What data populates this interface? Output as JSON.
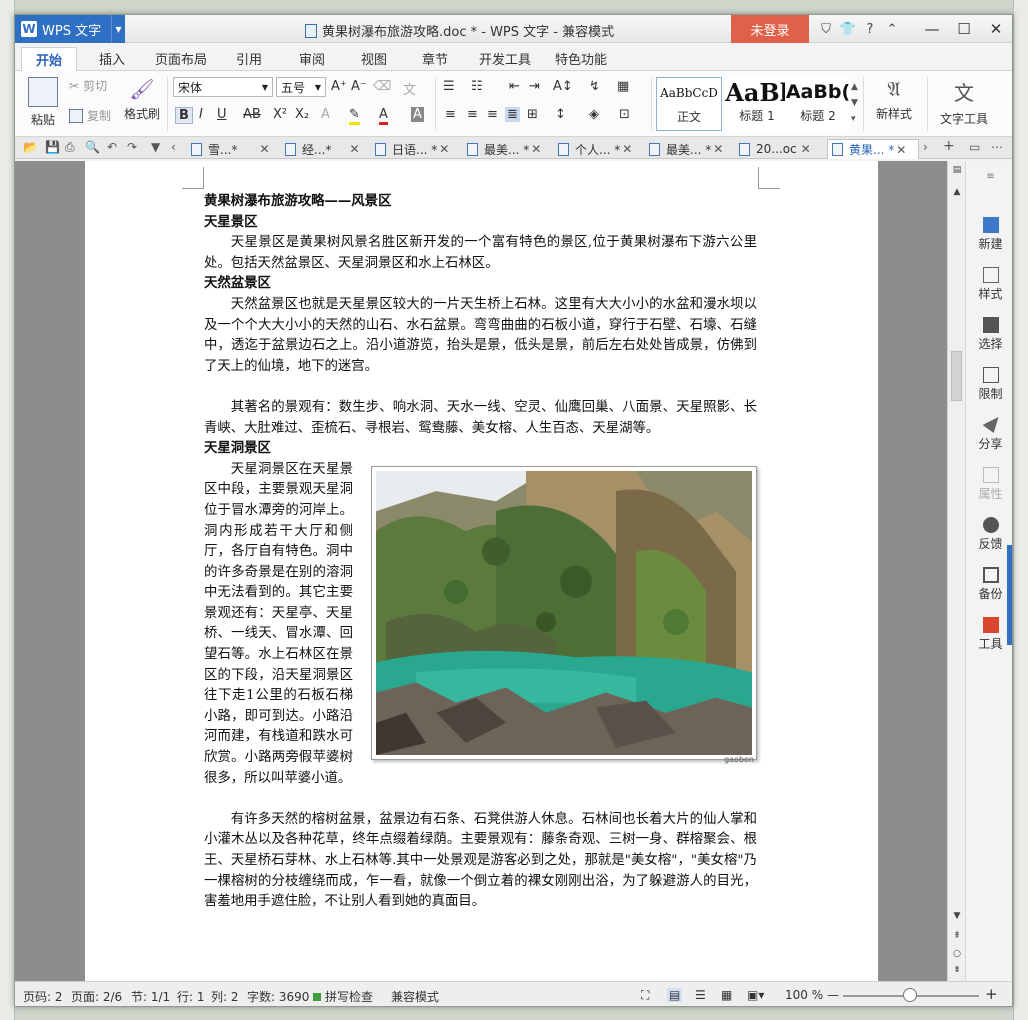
{
  "app": {
    "name": "WPS 文字",
    "window_title": "黄果树瀑布旅游攻略.doc * - WPS 文字 - 兼容模式",
    "login_label": "未登录",
    "title_icons": [
      "shield-icon",
      "shirt-icon",
      "help-icon",
      "collapse-icon"
    ],
    "help_label": "?"
  },
  "menu": {
    "tabs": [
      "开始",
      "插入",
      "页面布局",
      "引用",
      "审阅",
      "视图",
      "章节",
      "开发工具",
      "特色功能"
    ],
    "active": "开始"
  },
  "ribbon": {
    "paste": "粘贴",
    "cut": "剪切",
    "copy": "复制",
    "format_painter": "格式刷",
    "font_name": "宋体",
    "font_size": "五号",
    "styles": [
      {
        "preview": "AaBbCcD",
        "name": "正文"
      },
      {
        "preview": "AaBl",
        "name": "标题 1"
      },
      {
        "preview": "AaBb(",
        "name": "标题 2"
      }
    ],
    "new_style": "新样式",
    "text_tools": "文字工具"
  },
  "doc_tabs": [
    {
      "label": "雪...*"
    },
    {
      "label": "经...*"
    },
    {
      "label": "日语... *"
    },
    {
      "label": "最美... *"
    },
    {
      "label": "个人... *"
    },
    {
      "label": "最美... *"
    },
    {
      "label": "20...oc"
    },
    {
      "label": "黄果... *",
      "active": true
    }
  ],
  "document": {
    "title": "黄果树瀑布旅游攻略——风景区",
    "h1": "天星景区",
    "p1": "天星景区是黄果树风景名胜区新开发的一个富有特色的景区,位于黄果树瀑布下游六公里处。包括天然盆景区、天星洞景区和水上石林区。",
    "h2": "天然盆景区",
    "p2": "天然盆景区也就是天星景区较大的一片天生桥上石林。这里有大大小小的水盆和漫水坝以及一个个大大小小的天然的山石、水石盆景。弯弯曲曲的石板小道，穿行于石壁、石壕、石缝中，透迄于盆景边石之上。沿小道游览，抬头是景，低头是景，前后左右处处皆成景，仿佛到了天上的仙境，地下的迷宫。",
    "p3": "其著名的景观有：数生步、响水洞、天水一线、空灵、仙鹰回巢、八面景、天星照影、长青峡、大肚难过、歪梳石、寻根岩、鸳鸯藤、美女榕、人生百态、天星湖等。",
    "h3": "天星洞景区",
    "p4": "天星洞景区在天星景区中段，主要景观天星洞位于冒水潭旁的河岸上。洞内形成若干大厅和侧厅，各厅自有特色。洞中的许多奇景是在别的溶洞中无法看到的。其它主要景观还有：天星亭、天星桥、一线天、冒水潭、回望石等。水上石林区在景区的下段，沿天星洞景区往下走1公里的石板石梯小路，即可到达。小路沿河而建，有栈道和跌水可欣赏。小路两旁假苹婆树很多，所以叫苹婆小道。",
    "p5": "有许多天然的榕树盆景，盆景边有石条、石凳供游人休息。石林间也长着大片的仙人掌和小灌木丛以及各种花草，终年点缀着绿荫。主要景观有：藤条奇观、三树一身、群榕聚会、根王、天星桥石芽林、水上石林等.其中一处景观是游客必到之处，那就是\"美女榕\"，\"美女榕\"乃一棵榕树的分枝缠绕而成，乍一看，就像一个倒立着的裸女刚刚出浴，为了躲避游人的目光，害羞地用手遮住脸，不让别人看到她的真面目。",
    "image_caption": "gaobon"
  },
  "side_panel": [
    {
      "label": "新建",
      "icon": "new-doc-icon"
    },
    {
      "label": "样式",
      "icon": "style-icon"
    },
    {
      "label": "选择",
      "icon": "select-icon"
    },
    {
      "label": "限制",
      "icon": "lock-icon"
    },
    {
      "label": "分享",
      "icon": "share-icon"
    },
    {
      "label": "属性",
      "icon": "properties-icon",
      "disabled": true
    },
    {
      "label": "反馈",
      "icon": "feedback-icon"
    },
    {
      "label": "备份",
      "icon": "backup-icon"
    },
    {
      "label": "工具",
      "icon": "toolbox-icon"
    }
  ],
  "status": {
    "page_no": "页码: 2",
    "pages": "页面: 2/6",
    "section": "节: 1/1",
    "row": "行: 1",
    "col": "列: 2",
    "words": "字数: 3690",
    "spell": "拼写检查",
    "compat": "兼容模式",
    "zoom": "100 %"
  },
  "colors": {
    "accent": "#2f6fc4",
    "login": "#e0614a",
    "water": "#2aa88f"
  }
}
